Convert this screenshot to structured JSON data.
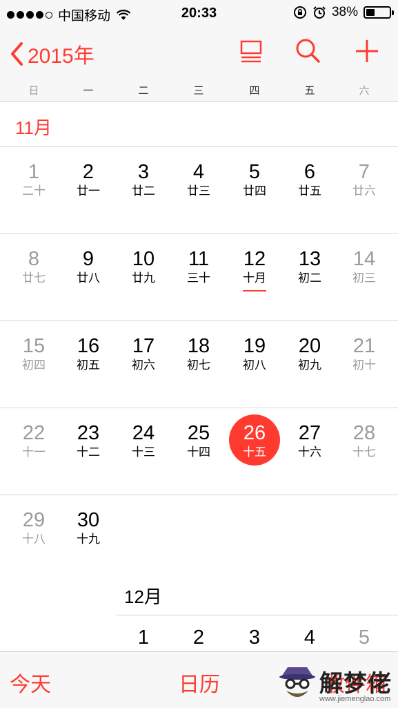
{
  "status_bar": {
    "carrier": "中国移动",
    "time": "20:33",
    "battery": "38%",
    "battery_level": 0.38,
    "signal_bars": 4
  },
  "nav": {
    "back_label": "2015年",
    "icons": [
      "list-view-icon",
      "search-icon",
      "add-icon"
    ]
  },
  "weekdays": [
    "日",
    "一",
    "二",
    "三",
    "四",
    "五",
    "六"
  ],
  "months": {
    "november": {
      "label": "11月",
      "days": [
        {
          "n": "1",
          "l": "二十"
        },
        {
          "n": "2",
          "l": "廿一"
        },
        {
          "n": "3",
          "l": "廿二"
        },
        {
          "n": "4",
          "l": "廿三"
        },
        {
          "n": "5",
          "l": "廿四"
        },
        {
          "n": "6",
          "l": "廿五"
        },
        {
          "n": "7",
          "l": "廿六"
        },
        {
          "n": "8",
          "l": "廿七"
        },
        {
          "n": "9",
          "l": "廿八"
        },
        {
          "n": "10",
          "l": "廿九"
        },
        {
          "n": "11",
          "l": "三十"
        },
        {
          "n": "12",
          "l": "十月"
        },
        {
          "n": "13",
          "l": "初二"
        },
        {
          "n": "14",
          "l": "初三"
        },
        {
          "n": "15",
          "l": "初四"
        },
        {
          "n": "16",
          "l": "初五"
        },
        {
          "n": "17",
          "l": "初六"
        },
        {
          "n": "18",
          "l": "初七"
        },
        {
          "n": "19",
          "l": "初八"
        },
        {
          "n": "20",
          "l": "初九"
        },
        {
          "n": "21",
          "l": "初十"
        },
        {
          "n": "22",
          "l": "十一"
        },
        {
          "n": "23",
          "l": "十二"
        },
        {
          "n": "24",
          "l": "十三"
        },
        {
          "n": "25",
          "l": "十四"
        },
        {
          "n": "26",
          "l": "十五"
        },
        {
          "n": "27",
          "l": "十六"
        },
        {
          "n": "28",
          "l": "十七"
        },
        {
          "n": "29",
          "l": "十八"
        },
        {
          "n": "30",
          "l": "十九"
        }
      ]
    },
    "december": {
      "label": "12月",
      "days": [
        {
          "n": "1"
        },
        {
          "n": "2"
        },
        {
          "n": "3"
        },
        {
          "n": "4"
        },
        {
          "n": "5"
        }
      ]
    }
  },
  "today": "26",
  "tabs": {
    "today": "今天",
    "calendars": "日历",
    "inbox": "收件箱"
  },
  "watermark": {
    "text": "解梦佬",
    "url": "www.jiemenglao.com"
  },
  "colors": {
    "accent": "#ff3b30",
    "weekend_grey": "#9b9b9b",
    "bar_bg": "#f7f7f7"
  }
}
